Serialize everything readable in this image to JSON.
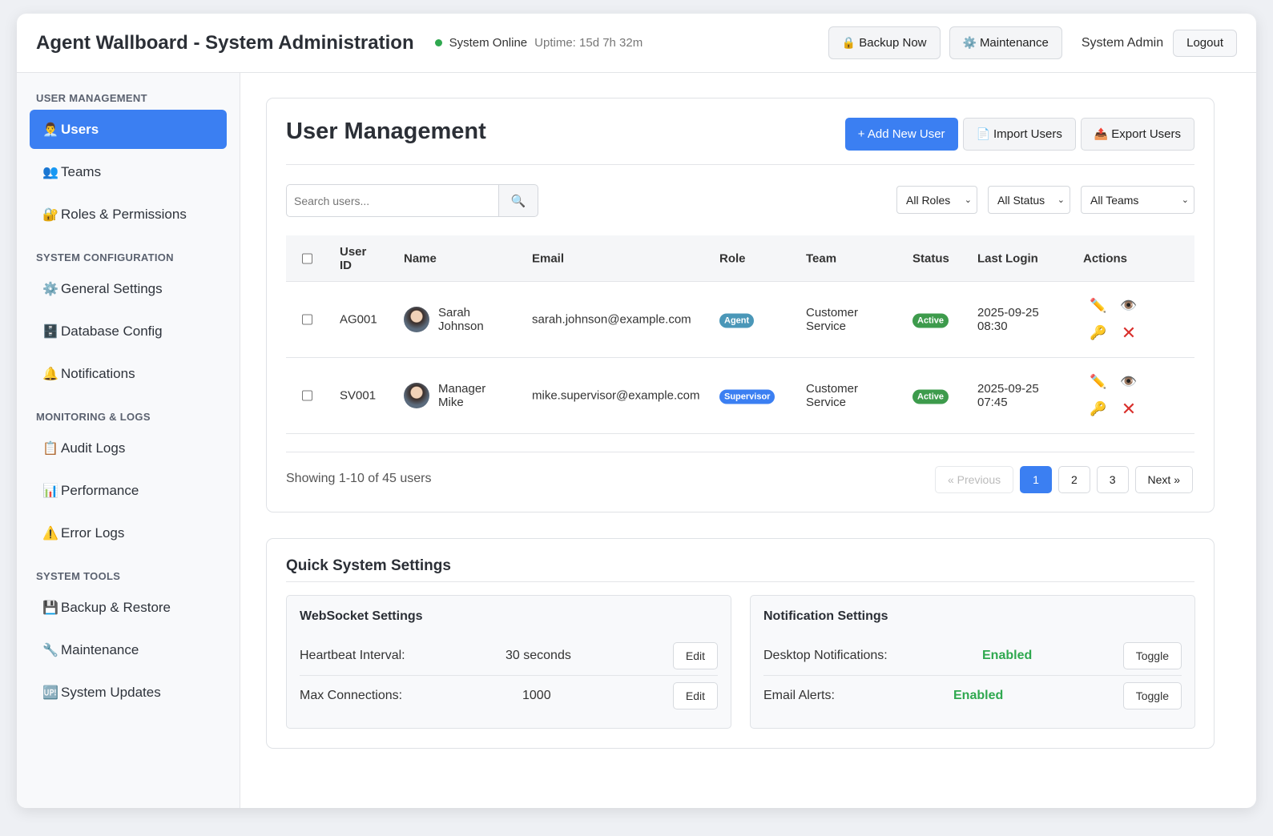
{
  "header": {
    "title": "Agent Wallboard - System Administration",
    "status_text": "System Online",
    "uptime": "Uptime: 15d 7h 32m",
    "backup_label": "Backup Now",
    "maintenance_label": "Maintenance",
    "admin_name": "System Admin",
    "logout_label": "Logout",
    "status_color": "#2fa84f"
  },
  "sidebar": {
    "sections": [
      {
        "title": "USER MANAGEMENT",
        "items": [
          {
            "icon": "👨‍💼",
            "label": "Users"
          },
          {
            "icon": "👥",
            "label": "Teams"
          },
          {
            "icon": "🔐",
            "label": "Roles & Permissions"
          }
        ]
      },
      {
        "title": "SYSTEM CONFIGURATION",
        "items": [
          {
            "icon": "⚙️",
            "label": "General Settings"
          },
          {
            "icon": "🗄️",
            "label": "Database Config"
          },
          {
            "icon": "🔔",
            "label": "Notifications"
          }
        ]
      },
      {
        "title": "MONITORING & LOGS",
        "items": [
          {
            "icon": "📋",
            "label": "Audit Logs"
          },
          {
            "icon": "📊",
            "label": "Performance"
          },
          {
            "icon": "⚠️",
            "label": "Error Logs"
          }
        ]
      },
      {
        "title": "SYSTEM TOOLS",
        "items": [
          {
            "icon": "💾",
            "label": "Backup & Restore"
          },
          {
            "icon": "🔧",
            "label": "Maintenance"
          },
          {
            "icon": "🆙",
            "label": "System Updates"
          }
        ]
      }
    ],
    "active_item": "Users"
  },
  "main": {
    "title": "User Management",
    "add_label": "+ Add New User",
    "import_label": "Import Users",
    "export_label": "Export Users",
    "search_placeholder": "Search users...",
    "filters": [
      "All Roles",
      "All Status",
      "All Teams"
    ],
    "columns": [
      "User ID",
      "Name",
      "Email",
      "Role",
      "Team",
      "Status",
      "Last Login",
      "Actions"
    ],
    "rows": [
      {
        "id": "AG001",
        "name": "Sarah Johnson",
        "email": "sarah.johnson@example.com",
        "role": "Agent",
        "team": "Customer Service",
        "status": "Active",
        "last_login_date": "2025-09-25",
        "last_login_time": "08:30"
      },
      {
        "id": "SV001",
        "name": "Manager Mike",
        "email": "mike.supervisor@example.com",
        "role": "Supervisor",
        "team": "Customer Service",
        "status": "Active",
        "last_login_date": "2025-09-25",
        "last_login_time": "07:45"
      }
    ],
    "showing": "Showing 1-10 of 45 users",
    "pagination": {
      "previous": "« Previous",
      "pages": [
        "1",
        "2",
        "3"
      ],
      "current": "1",
      "next": "Next »"
    }
  },
  "quick_settings": {
    "title": "Quick System Settings",
    "websocket": {
      "title": "WebSocket Settings",
      "heartbeat_label": "Heartbeat Interval:",
      "heartbeat_value": "30 seconds",
      "max_conn_label": "Max Connections:",
      "max_conn_value": "1000",
      "edit_label": "Edit"
    },
    "notifications": {
      "title": "Notification Settings",
      "desktop_label": "Desktop Notifications:",
      "desktop_value": "Enabled",
      "email_label": "Email Alerts:",
      "email_value": "Enabled",
      "toggle_label": "Toggle"
    }
  },
  "colors": {
    "accent": "#3b7ff2",
    "success": "#2fa84f",
    "danger": "#d9302c"
  }
}
